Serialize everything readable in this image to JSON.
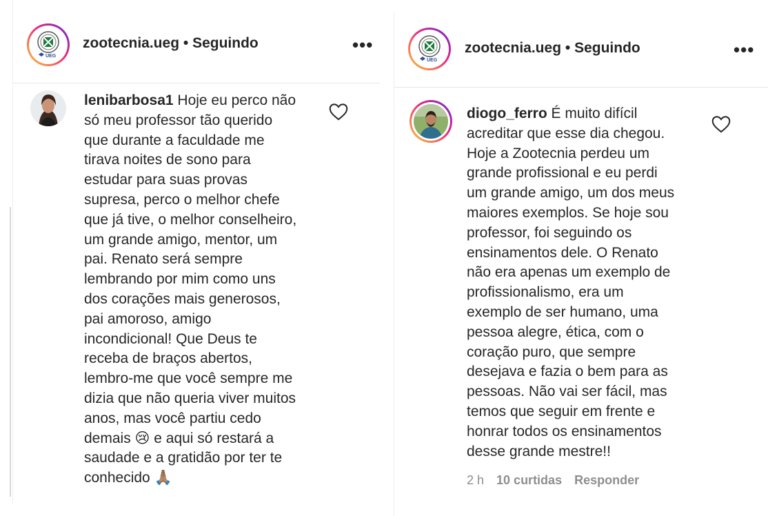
{
  "left": {
    "header": {
      "account": "zootecnia.ueg",
      "separator": "•",
      "follow_status": "Seguindo",
      "more": "•••"
    },
    "comment": {
      "username": "lenibarbosa1",
      "lines": [
        "Hoje eu perco não",
        "só meu professor tão querido",
        "que durante a faculdade me",
        "tirava noites de sono para",
        "estudar para suas provas",
        "supresa, perco o melhor chefe",
        "que já tive, o melhor conselheiro,",
        "um grande amigo, mentor, um",
        "pai. Renato será sempre",
        "lembrando por mim como uns",
        "dos corações mais generosos,",
        "pai amoroso, amigo",
        "incondicional! Que Deus te",
        "receba de braços abertos,",
        "lembro-me que você sempre me",
        "dizia que não queria viver muitos",
        "anos, mas você partiu cedo",
        "demais 😢 e aqui só restará a",
        "saudade e a gratidão por ter te",
        "conhecido 🙏🏽"
      ]
    }
  },
  "right": {
    "header": {
      "account": "zootecnia.ueg",
      "separator": "•",
      "follow_status": "Seguindo",
      "more": "•••"
    },
    "comment": {
      "username": "diogo_ferro",
      "lines": [
        "É muito difícil",
        "acreditar que esse dia chegou.",
        "Hoje a Zootecnia perdeu um",
        "grande profissional e eu perdi",
        "um grande amigo, um dos meus",
        "maiores exemplos. Se hoje sou",
        "professor, foi seguindo os",
        "ensinamentos dele. O Renato",
        "não era apenas um exemplo de",
        "profissionalismo, era um",
        "exemplo de ser humano, uma",
        "pessoa alegre, ética, com o",
        "coração puro, que sempre",
        "desejava e fazia o bem para as",
        "pessoas. Não vai ser fácil, mas",
        "temos que seguir em frente e",
        "honrar todos os ensinamentos",
        "desse grande mestre!!"
      ],
      "time": "2 h",
      "likes": "10 curtidas",
      "reply": "Responder"
    }
  },
  "logo": {
    "label": "UEG"
  },
  "colors": {
    "text": "#262626",
    "muted": "#8e8e8e",
    "border": "#efefef",
    "logo_green": "#1b7a3a"
  }
}
